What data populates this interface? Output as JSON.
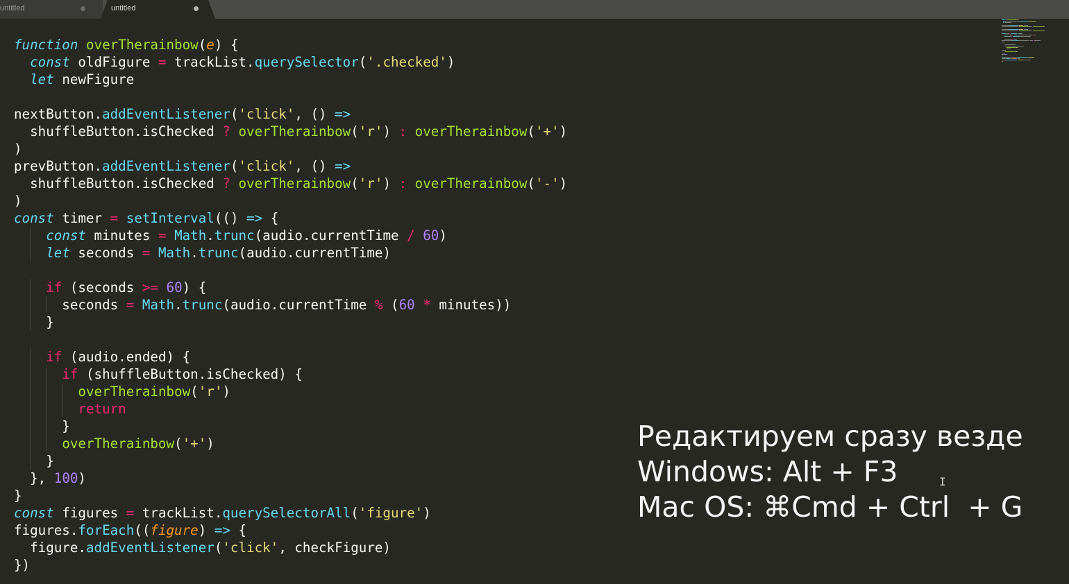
{
  "tabs": [
    {
      "label": "untitled",
      "active": false
    },
    {
      "label": "untitled",
      "active": true
    }
  ],
  "code_lines": [
    [
      [
        "kw",
        "function"
      ],
      [
        "t",
        " "
      ],
      [
        "fn",
        "overTherainbow"
      ],
      [
        "t",
        "("
      ],
      [
        "arg",
        "e"
      ],
      [
        "t",
        ") {"
      ]
    ],
    [
      [
        "t",
        "  "
      ],
      [
        "kw",
        "const"
      ],
      [
        "t",
        " oldFigure "
      ],
      [
        "op",
        "="
      ],
      [
        "t",
        " trackList."
      ],
      [
        "sup",
        "querySelector"
      ],
      [
        "t",
        "("
      ],
      [
        "str",
        "'.checked'"
      ],
      [
        "t",
        ")"
      ]
    ],
    [
      [
        "t",
        "  "
      ],
      [
        "kw",
        "let"
      ],
      [
        "t",
        " newFigure"
      ]
    ],
    [],
    [
      [
        "t",
        "nextButton."
      ],
      [
        "sup",
        "addEventListener"
      ],
      [
        "t",
        "("
      ],
      [
        "str",
        "'click'"
      ],
      [
        "t",
        ", () "
      ],
      [
        "kw",
        "=>"
      ]
    ],
    [
      [
        "t",
        "  shuffleButton.isChecked "
      ],
      [
        "op",
        "?"
      ],
      [
        "t",
        " "
      ],
      [
        "fn",
        "overTherainbow"
      ],
      [
        "t",
        "("
      ],
      [
        "str",
        "'r'"
      ],
      [
        "t",
        ") "
      ],
      [
        "op",
        ":"
      ],
      [
        "t",
        " "
      ],
      [
        "fn",
        "overTherainbow"
      ],
      [
        "t",
        "("
      ],
      [
        "str",
        "'+'"
      ],
      [
        "t",
        ")"
      ]
    ],
    [
      [
        "t",
        ")"
      ]
    ],
    [
      [
        "t",
        "prevButton."
      ],
      [
        "sup",
        "addEventListener"
      ],
      [
        "t",
        "("
      ],
      [
        "str",
        "'click'"
      ],
      [
        "t",
        ", () "
      ],
      [
        "kw",
        "=>"
      ]
    ],
    [
      [
        "t",
        "  shuffleButton.isChecked "
      ],
      [
        "op",
        "?"
      ],
      [
        "t",
        " "
      ],
      [
        "fn",
        "overTherainbow"
      ],
      [
        "t",
        "("
      ],
      [
        "str",
        "'r'"
      ],
      [
        "t",
        ") "
      ],
      [
        "op",
        ":"
      ],
      [
        "t",
        " "
      ],
      [
        "fn",
        "overTherainbow"
      ],
      [
        "t",
        "("
      ],
      [
        "str",
        "'-'"
      ],
      [
        "t",
        ")"
      ]
    ],
    [
      [
        "t",
        ")"
      ]
    ],
    [
      [
        "kw",
        "const"
      ],
      [
        "t",
        " timer "
      ],
      [
        "op",
        "="
      ],
      [
        "t",
        " "
      ],
      [
        "sup",
        "setInterval"
      ],
      [
        "t",
        "(() "
      ],
      [
        "kw",
        "=>"
      ],
      [
        "t",
        " {"
      ]
    ],
    [
      [
        "t",
        "    "
      ],
      [
        "kw",
        "const"
      ],
      [
        "t",
        " minutes "
      ],
      [
        "op",
        "="
      ],
      [
        "t",
        " "
      ],
      [
        "sup",
        "Math"
      ],
      [
        "t",
        "."
      ],
      [
        "sup",
        "trunc"
      ],
      [
        "t",
        "(audio.currentTime "
      ],
      [
        "op",
        "/"
      ],
      [
        "t",
        " "
      ],
      [
        "num",
        "60"
      ],
      [
        "t",
        ")"
      ]
    ],
    [
      [
        "t",
        "    "
      ],
      [
        "kw",
        "let"
      ],
      [
        "t",
        " seconds "
      ],
      [
        "op",
        "="
      ],
      [
        "t",
        " "
      ],
      [
        "sup",
        "Math"
      ],
      [
        "t",
        "."
      ],
      [
        "sup",
        "trunc"
      ],
      [
        "t",
        "(audio.currentTime)"
      ]
    ],
    [],
    [
      [
        "t",
        "    "
      ],
      [
        "ctl",
        "if"
      ],
      [
        "t",
        " (seconds "
      ],
      [
        "op",
        ">="
      ],
      [
        "t",
        " "
      ],
      [
        "num",
        "60"
      ],
      [
        "t",
        ") {"
      ]
    ],
    [
      [
        "t",
        "      seconds "
      ],
      [
        "op",
        "="
      ],
      [
        "t",
        " "
      ],
      [
        "sup",
        "Math"
      ],
      [
        "t",
        "."
      ],
      [
        "sup",
        "trunc"
      ],
      [
        "t",
        "(audio.currentTime "
      ],
      [
        "op",
        "%"
      ],
      [
        "t",
        " ("
      ],
      [
        "num",
        "60"
      ],
      [
        "t",
        " "
      ],
      [
        "op",
        "*"
      ],
      [
        "t",
        " minutes))"
      ]
    ],
    [
      [
        "t",
        "    }"
      ]
    ],
    [],
    [
      [
        "t",
        "    "
      ],
      [
        "ctl",
        "if"
      ],
      [
        "t",
        " (audio.ended) {"
      ]
    ],
    [
      [
        "t",
        "      "
      ],
      [
        "ctl",
        "if"
      ],
      [
        "t",
        " (shuffleButton.isChecked) {"
      ]
    ],
    [
      [
        "t",
        "        "
      ],
      [
        "fn",
        "overTherainbow"
      ],
      [
        "t",
        "("
      ],
      [
        "str",
        "'r'"
      ],
      [
        "t",
        ")"
      ]
    ],
    [
      [
        "t",
        "        "
      ],
      [
        "ctl",
        "return"
      ]
    ],
    [
      [
        "t",
        "      }"
      ]
    ],
    [
      [
        "t",
        "      "
      ],
      [
        "fn",
        "overTherainbow"
      ],
      [
        "t",
        "("
      ],
      [
        "str",
        "'+'"
      ],
      [
        "t",
        ")"
      ]
    ],
    [
      [
        "t",
        "    }"
      ]
    ],
    [
      [
        "t",
        "  }, "
      ],
      [
        "num",
        "100"
      ],
      [
        "t",
        ")"
      ]
    ],
    [
      [
        "t",
        "}"
      ]
    ],
    [
      [
        "kw",
        "const"
      ],
      [
        "t",
        " figures "
      ],
      [
        "op",
        "="
      ],
      [
        "t",
        " trackList."
      ],
      [
        "sup",
        "querySelectorAll"
      ],
      [
        "t",
        "("
      ],
      [
        "str",
        "'figure'"
      ],
      [
        "t",
        ")"
      ]
    ],
    [
      [
        "t",
        "figures."
      ],
      [
        "sup",
        "forEach"
      ],
      [
        "t",
        "(("
      ],
      [
        "arg",
        "figure"
      ],
      [
        "t",
        ") "
      ],
      [
        "kw",
        "=>"
      ],
      [
        "t",
        " {"
      ]
    ],
    [
      [
        "t",
        "  figure."
      ],
      [
        "sup",
        "addEventListener"
      ],
      [
        "t",
        "("
      ],
      [
        "str",
        "'click'"
      ],
      [
        "t",
        ", checkFigure)"
      ]
    ],
    [
      [
        "t",
        "})"
      ]
    ]
  ],
  "overlay": {
    "line1": "Редактируем сразу везде",
    "line2": "Windows: Alt + F3",
    "line3": "Mac OS: ⌘Cmd + Ctrl  + G"
  },
  "colors": {
    "background": "#272822",
    "text": "#f8f8f2",
    "keyword": "#66d9ef",
    "function": "#a6e22e",
    "argument": "#fd971f",
    "operator": "#f92672",
    "string": "#e6db74",
    "number": "#ae81ff"
  }
}
